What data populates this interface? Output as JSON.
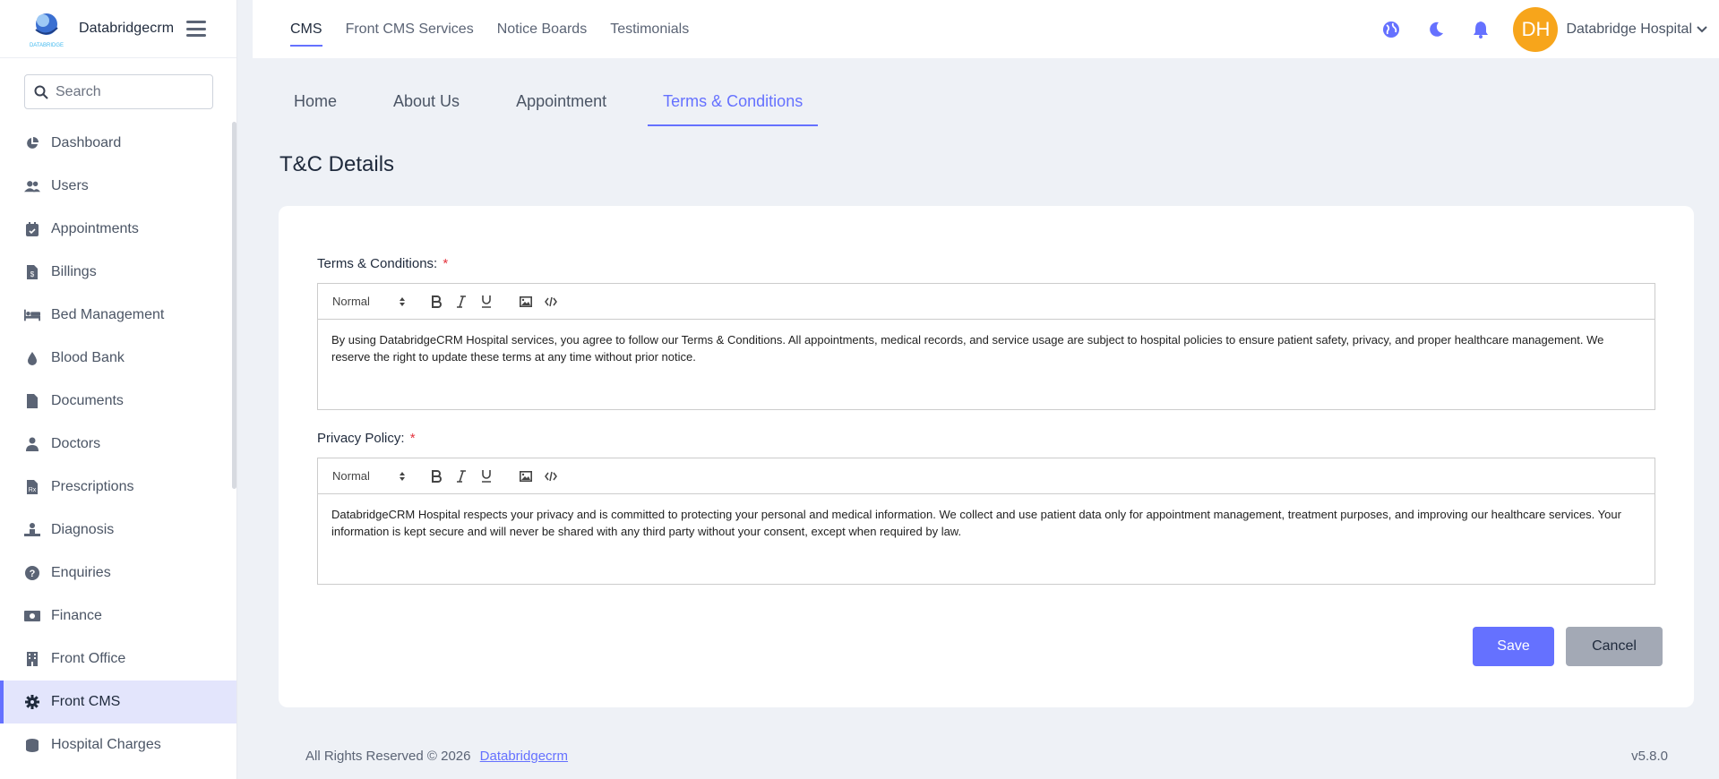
{
  "app": {
    "brand_name": "Databridgecrm",
    "logo_caption": "DATABRIDGE"
  },
  "sidebar": {
    "search_placeholder": "Search",
    "items": [
      {
        "label": "Dashboard",
        "icon": "pie-chart-icon"
      },
      {
        "label": "Users",
        "icon": "users-icon"
      },
      {
        "label": "Appointments",
        "icon": "calendar-check-icon"
      },
      {
        "label": "Billings",
        "icon": "file-invoice-icon"
      },
      {
        "label": "Bed Management",
        "icon": "bed-icon"
      },
      {
        "label": "Blood Bank",
        "icon": "droplet-icon"
      },
      {
        "label": "Documents",
        "icon": "file-icon"
      },
      {
        "label": "Doctors",
        "icon": "user-doctor-icon"
      },
      {
        "label": "Prescriptions",
        "icon": "prescription-icon"
      },
      {
        "label": "Diagnosis",
        "icon": "diagnosis-icon"
      },
      {
        "label": "Enquiries",
        "icon": "question-circle-icon"
      },
      {
        "label": "Finance",
        "icon": "money-bill-icon"
      },
      {
        "label": "Front Office",
        "icon": "building-icon"
      },
      {
        "label": "Front CMS",
        "icon": "gear-icon",
        "active": true
      },
      {
        "label": "Hospital Charges",
        "icon": "coins-icon"
      }
    ]
  },
  "topbar": {
    "links": [
      {
        "label": "CMS",
        "active": true
      },
      {
        "label": "Front CMS Services"
      },
      {
        "label": "Notice Boards"
      },
      {
        "label": "Testimonials"
      }
    ],
    "avatar_initials": "DH",
    "user_name": "Databridge Hospital",
    "accent_color": "#6571ff",
    "avatar_color": "#f7a51b"
  },
  "tabs": [
    {
      "label": "Home"
    },
    {
      "label": "About Us"
    },
    {
      "label": "Appointment"
    },
    {
      "label": "Terms & Conditions",
      "active": true
    }
  ],
  "page_title": "T&C Details",
  "form": {
    "terms": {
      "label": "Terms & Conditions:",
      "required_mark": "*",
      "format": "Normal",
      "content": "By using DatabridgeCRM Hospital services, you agree to follow our Terms & Conditions. All appointments, medical records, and service usage are subject to hospital policies to ensure patient safety, privacy, and proper healthcare management. We reserve the right to update these terms at any time without prior notice."
    },
    "privacy": {
      "label": "Privacy Policy:",
      "required_mark": "*",
      "format": "Normal",
      "content": "DatabridgeCRM Hospital respects your privacy and is committed to protecting your personal and medical information. We collect and use patient data only for appointment management, treatment purposes, and improving our healthcare services. Your information is kept secure and will never be shared with any third party without your consent, except when required by law."
    },
    "save_label": "Save",
    "cancel_label": "Cancel"
  },
  "footer": {
    "copyright": "All Rights Reserved © 2026",
    "link": "Databridgecrm",
    "version": "v5.8.0"
  }
}
